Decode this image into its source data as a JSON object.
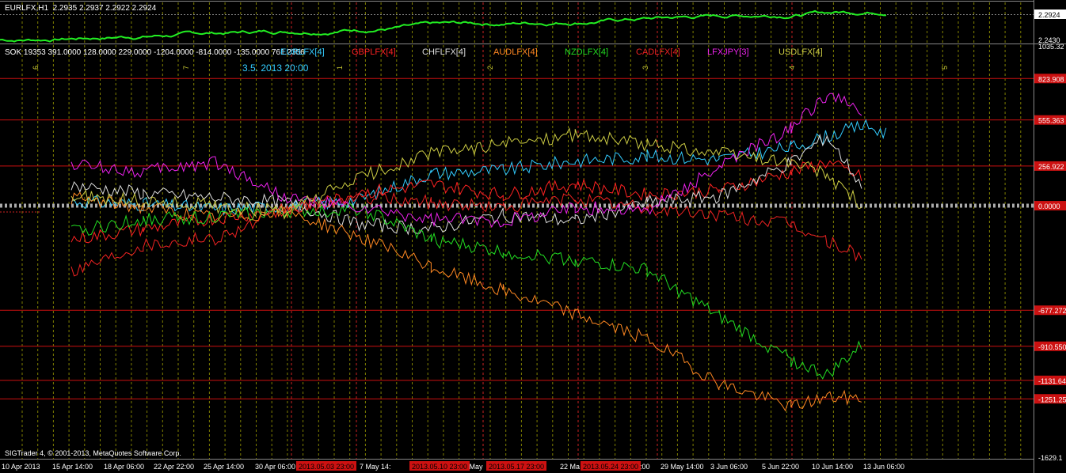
{
  "window": {
    "symbol_label": "EURLFX,H1",
    "ohlc": "2.2935 2.2937 2.2922 2.2924",
    "indicator_label": "SOK 19353 391.0000 128.0000 229.0000 -1204.0000 -814.0000 -135.0000 761.2356",
    "cursor_time": "3.5. 2013 20:00",
    "copyright": "SIGTrader 4, © 2001-2013, MetaQuotes Software Corp."
  },
  "legend": [
    {
      "label": "EURLFX[4]",
      "color": "#33ccff"
    },
    {
      "label": "GBPLFX[4]",
      "color": "#ff2222"
    },
    {
      "label": "CHFLFX[4]",
      "color": "#dddddd"
    },
    {
      "label": "AUDLFX[4]",
      "color": "#ff8822"
    },
    {
      "label": "NZDLFX[4]",
      "color": "#22dd22"
    },
    {
      "label": "CADLFX[4]",
      "color": "#ee2222"
    },
    {
      "label": "LFXJPY[3]",
      "color": "#ee22ee"
    },
    {
      "label": "USDLFX[4]",
      "color": "#cccc44"
    }
  ],
  "chart_data": [
    {
      "type": "line",
      "title": "EURLFX,H1",
      "y_ticks": [
        "2.2924",
        "2.2430"
      ],
      "ylim": [
        2.243,
        2.2924
      ],
      "series": [
        {
          "name": "EURLFX",
          "color": "#22ee22"
        }
      ]
    },
    {
      "type": "line",
      "title": "SOK",
      "y_ticks": [
        "1035.32",
        "823.908",
        "555.363",
        "256.922",
        "0.0000",
        "-677.272",
        "-910.550",
        "-1131.64",
        "-1251.25",
        "-1629.1"
      ],
      "level_lines": [
        "823.908",
        "555.363",
        "256.922",
        "-677.272",
        "-910.550",
        "-1131.64",
        "-1251.25"
      ],
      "ylim": [
        -1629.1,
        1035.32
      ],
      "x_ticks": [
        "10 Apr 2013",
        "15 Apr 14:00",
        "18 Apr 06:00",
        "22 Apr 22:00",
        "25 Apr 14:00",
        "30 Apr 06:00",
        "7 May 14:",
        "14 May",
        "22 Ma",
        ":00",
        "29 May 14:00",
        "3 Jun 06:00",
        "5 Jun 22:00",
        "10 Jun 14:00",
        "13 Jun 06:00"
      ],
      "time_markers": [
        "2013.05.03 23:00",
        "2013.05.10 23:00",
        "2013.05.17 23:00",
        "2013.05.24 23:00"
      ],
      "period_numbers": [
        "1",
        "2",
        "3",
        "4",
        "5",
        "6",
        "7"
      ],
      "series": [
        {
          "name": "EURLFX",
          "color": "#33ccff",
          "points": [
            [
              0,
              30
            ],
            [
              30,
              10
            ],
            [
              60,
              -20
            ],
            [
              90,
              -5
            ],
            [
              120,
              40
            ],
            [
              150,
              210
            ],
            [
              180,
              230
            ],
            [
              210,
              290
            ],
            [
              240,
              320
            ],
            [
              270,
              300
            ],
            [
              300,
              380
            ],
            [
              330,
              520
            ],
            [
              340,
              470
            ]
          ]
        },
        {
          "name": "GBPLFX",
          "color": "#ff2222",
          "points": [
            [
              0,
              -220
            ],
            [
              30,
              -150
            ],
            [
              60,
              -80
            ],
            [
              90,
              -30
            ],
            [
              120,
              80
            ],
            [
              150,
              140
            ],
            [
              180,
              70
            ],
            [
              210,
              140
            ],
            [
              240,
              70
            ],
            [
              270,
              100
            ],
            [
              300,
              220
            ],
            [
              315,
              280
            ],
            [
              330,
              180
            ]
          ]
        },
        {
          "name": "CHFLFX",
          "color": "#dddddd",
          "points": [
            [
              0,
              130
            ],
            [
              30,
              80
            ],
            [
              60,
              50
            ],
            [
              90,
              20
            ],
            [
              120,
              -120
            ],
            [
              150,
              -150
            ],
            [
              180,
              -60
            ],
            [
              210,
              -100
            ],
            [
              240,
              20
            ],
            [
              270,
              60
            ],
            [
              300,
              280
            ],
            [
              315,
              450
            ],
            [
              330,
              120
            ]
          ]
        },
        {
          "name": "AUDLFX",
          "color": "#ff8822",
          "points": [
            [
              0,
              50
            ],
            [
              30,
              -10
            ],
            [
              60,
              -80
            ],
            [
              90,
              -40
            ],
            [
              120,
              -200
            ],
            [
              150,
              -400
            ],
            [
              180,
              -550
            ],
            [
              210,
              -700
            ],
            [
              240,
              -860
            ],
            [
              270,
              -1150
            ],
            [
              300,
              -1300
            ],
            [
              315,
              -1240
            ],
            [
              330,
              -1250
            ]
          ]
        },
        {
          "name": "NZDLFX",
          "color": "#22dd22",
          "points": [
            [
              0,
              -170
            ],
            [
              30,
              -90
            ],
            [
              60,
              -70
            ],
            [
              90,
              -40
            ],
            [
              120,
              -20
            ],
            [
              150,
              -220
            ],
            [
              180,
              -300
            ],
            [
              210,
              -350
            ],
            [
              240,
              -420
            ],
            [
              270,
              -720
            ],
            [
              300,
              -1000
            ],
            [
              315,
              -1100
            ],
            [
              330,
              -900
            ]
          ]
        },
        {
          "name": "CADLFX",
          "color": "#ee2222",
          "points": [
            [
              0,
              -420
            ],
            [
              30,
              -250
            ],
            [
              60,
              -210
            ],
            [
              90,
              -30
            ],
            [
              120,
              60
            ],
            [
              150,
              20
            ],
            [
              180,
              -10
            ],
            [
              210,
              50
            ],
            [
              240,
              -20
            ],
            [
              270,
              -60
            ],
            [
              300,
              -120
            ],
            [
              315,
              -230
            ],
            [
              330,
              -330
            ]
          ]
        },
        {
          "name": "LFXJPY",
          "color": "#ee22ee",
          "points": [
            [
              0,
              270
            ],
            [
              30,
              220
            ],
            [
              60,
              280
            ],
            [
              90,
              50
            ],
            [
              120,
              -20
            ],
            [
              150,
              -90
            ],
            [
              180,
              -100
            ],
            [
              210,
              -10
            ],
            [
              240,
              -30
            ],
            [
              270,
              250
            ],
            [
              300,
              500
            ],
            [
              315,
              720
            ],
            [
              330,
              600
            ]
          ]
        },
        {
          "name": "USDLFX",
          "color": "#cccc44",
          "points": [
            [
              0,
              60
            ],
            [
              30,
              30
            ],
            [
              60,
              0
            ],
            [
              90,
              -40
            ],
            [
              120,
              180
            ],
            [
              150,
              340
            ],
            [
              180,
              400
            ],
            [
              210,
              460
            ],
            [
              240,
              400
            ],
            [
              270,
              340
            ],
            [
              300,
              280
            ],
            [
              315,
              200
            ],
            [
              330,
              0
            ]
          ]
        }
      ]
    }
  ]
}
